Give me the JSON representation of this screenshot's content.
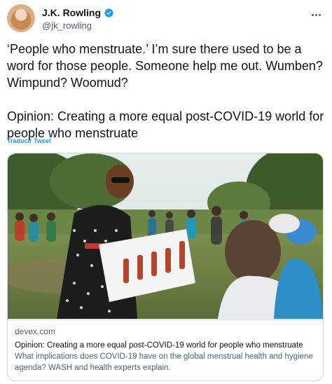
{
  "author": {
    "display_name": "J.K. Rowling",
    "handle": "@jk_rowling"
  },
  "tweet": {
    "text": "‘People who menstruate.’ I’m sure there used to be a word for those people. Someone help me out. Wumben? Wimpund? Woomud?\n\nOpinion: Creating a more equal post-COVID-19 world for people who menstruate",
    "translate_label": "Traducir Tweet"
  },
  "link_card": {
    "domain": "devex.com",
    "title": "Opinion: Creating a more equal post-COVID-19 world for people who menstruate",
    "description": "What implications does COVID-19 have on the global menstrual health and hygiene agenda? WASH and health experts explain."
  },
  "colors": {
    "link_blue": "#1d9bf0",
    "verified_blue": "#1d9bf0",
    "secondary_text": "#536471",
    "border": "#cfd9de"
  },
  "icons": [
    "verified-badge-icon",
    "more-options-icon"
  ]
}
